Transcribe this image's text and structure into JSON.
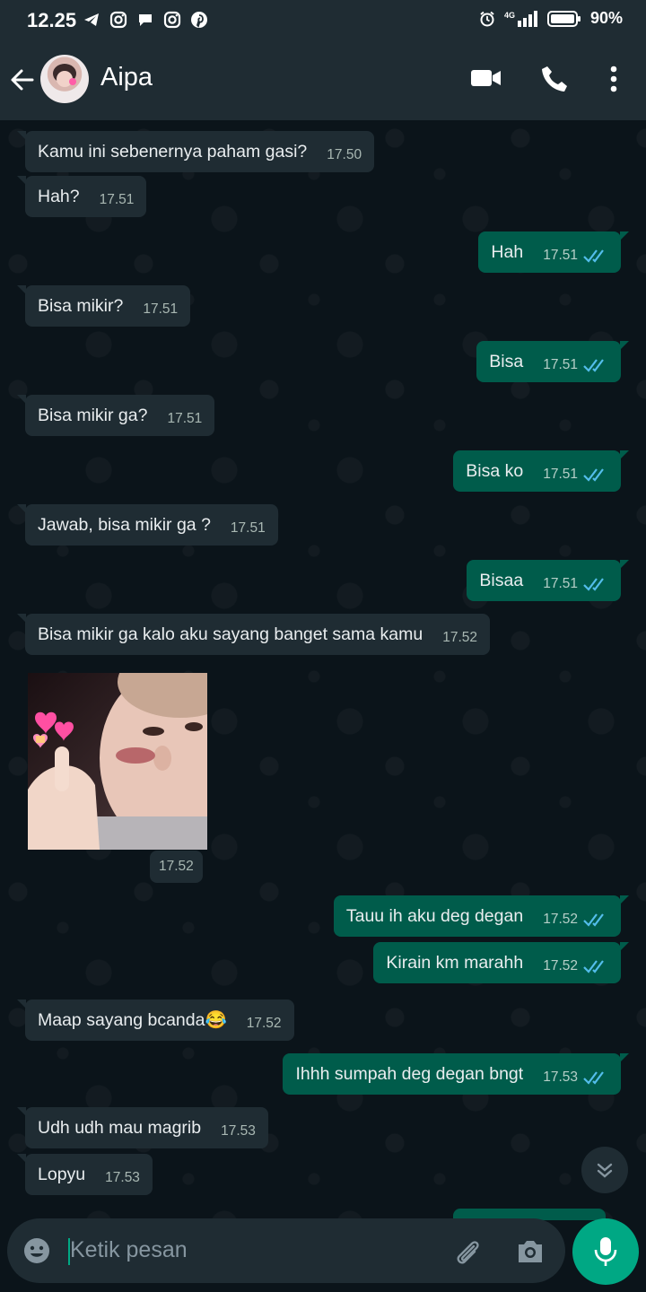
{
  "status_bar": {
    "time": "12.25",
    "signal": "4G",
    "battery": "90%",
    "notification_icons": [
      "telegram-icon",
      "instagram-icon",
      "message-icon",
      "instagram-icon",
      "pinterest-icon"
    ]
  },
  "header": {
    "contact_name": "Aipa",
    "icons": [
      "back-arrow-icon",
      "video-call-icon",
      "phone-icon",
      "more-vert-icon"
    ]
  },
  "messages": [
    {
      "dir": "in",
      "text": "Kamu ini sebenernya paham gasi?",
      "time": "17.50"
    },
    {
      "dir": "in",
      "text": "Hah?",
      "time": "17.51"
    },
    {
      "dir": "out",
      "text": "Hah",
      "time": "17.51",
      "status": "read"
    },
    {
      "dir": "in",
      "text": "Bisa mikir?",
      "time": "17.51"
    },
    {
      "dir": "out",
      "text": "Bisa",
      "time": "17.51",
      "status": "read"
    },
    {
      "dir": "in",
      "text": "Bisa mikir ga?",
      "time": "17.51"
    },
    {
      "dir": "out",
      "text": "Bisa ko",
      "time": "17.51",
      "status": "read"
    },
    {
      "dir": "in",
      "text": "Jawab, bisa mikir ga ?",
      "time": "17.51"
    },
    {
      "dir": "out",
      "text": "Bisaa",
      "time": "17.51",
      "status": "read"
    },
    {
      "dir": "in",
      "text": "Bisa mikir ga kalo aku sayang banget sama kamu",
      "time": "17.52"
    },
    {
      "dir": "in",
      "type": "image",
      "time": "17.52"
    },
    {
      "dir": "out",
      "text": "Tauu ih aku deg degan",
      "time": "17.52",
      "status": "read"
    },
    {
      "dir": "out",
      "text": "Kirain km marahh",
      "time": "17.52",
      "status": "read"
    },
    {
      "dir": "in",
      "text": "Maap sayang bcanda😂",
      "time": "17.52"
    },
    {
      "dir": "out",
      "text": "Ihhh sumpah deg degan bngt",
      "time": "17.53",
      "status": "read"
    },
    {
      "dir": "in",
      "text": "Udh udh mau magrib",
      "time": "17.53"
    },
    {
      "dir": "in",
      "text": "Lopyu",
      "time": "17.53"
    }
  ],
  "input": {
    "placeholder": "Ketik pesan"
  },
  "colors": {
    "background": "#0b141a",
    "bar": "#1f2c33",
    "incoming_bubble": "#1f2c33",
    "outgoing_bubble": "#005c4b",
    "accent": "#00a884",
    "read_tick": "#53bdeb"
  }
}
